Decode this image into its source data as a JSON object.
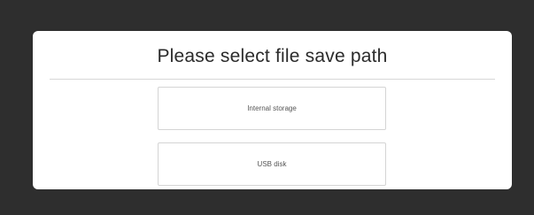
{
  "dialog": {
    "title": "Please select file save path",
    "options": [
      {
        "label": "Internal storage"
      },
      {
        "label": "USB disk"
      }
    ]
  },
  "colors": {
    "backdrop": "#2e2e2e",
    "dialog_background": "#ffffff",
    "divider": "#d7d7d7",
    "button_border": "#d4d4d4"
  }
}
